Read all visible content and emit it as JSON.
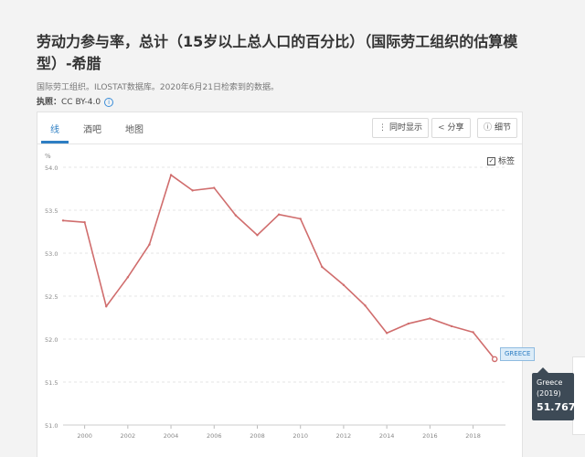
{
  "title": "劳动力参与率，总计（15岁以上总人口的百分比）（国际劳工组织的估算模型）-希腊",
  "source": "国际劳工组织。ILOSTAT数据库。2020年6月21日检索到的数据。",
  "license": {
    "label": "执照：",
    "value": "CC BY-4.0",
    "icon": "info-icon"
  },
  "tabs": [
    {
      "label": "线",
      "active": true
    },
    {
      "label": "酒吧",
      "active": false
    },
    {
      "label": "地图",
      "active": false
    }
  ],
  "toolbar": {
    "compare_label": "同时显示",
    "share_label": "分享",
    "details_label": "细节",
    "compare_icon": "menu-dots-icon",
    "share_icon": "share-icon",
    "details_icon": "info-icon"
  },
  "label_toggle": {
    "label": "标签",
    "checked": true
  },
  "series_label": "GREECE",
  "tooltip": {
    "name": "Greece",
    "year": "(2019)",
    "value": "51.767"
  },
  "colors": {
    "line": "#d06d6d",
    "accent": "#2d7ec3",
    "tooltip_bg": "#3d4a56"
  },
  "chart_data": {
    "type": "line",
    "unit_label": "%",
    "x": [
      1999,
      2000,
      2001,
      2002,
      2003,
      2004,
      2005,
      2006,
      2007,
      2008,
      2009,
      2010,
      2011,
      2012,
      2013,
      2014,
      2015,
      2016,
      2017,
      2018,
      2019
    ],
    "series": [
      {
        "name": "GREECE",
        "values": [
          53.38,
          53.36,
          52.38,
          52.72,
          53.1,
          53.91,
          53.73,
          53.76,
          53.44,
          53.21,
          53.45,
          53.4,
          52.84,
          52.63,
          52.39,
          52.07,
          52.18,
          52.24,
          52.15,
          52.08,
          51.767
        ]
      }
    ],
    "xticks": [
      "2000",
      "2002",
      "2004",
      "2006",
      "2008",
      "2010",
      "2012",
      "2014",
      "2016",
      "2018"
    ],
    "yticks": [
      "51.0",
      "51.5",
      "52.0",
      "52.5",
      "53.0",
      "53.5",
      "54.0"
    ],
    "ylim": [
      51.0,
      54.0
    ],
    "xlim": [
      1999,
      2019.5
    ],
    "grid": true,
    "legend": "none"
  }
}
